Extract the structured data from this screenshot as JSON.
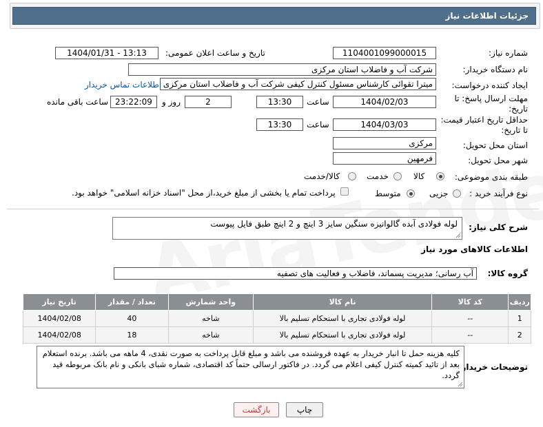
{
  "header": {
    "title": "جزئیات اطلاعات نیاز"
  },
  "form": {
    "need_number": {
      "label": "شماره نیاز:",
      "value": "1104001099000015"
    },
    "announce_datetime": {
      "label": "تاریخ و ساعت اعلان عمومی:",
      "value": "1404/01/31 - 13:13"
    },
    "buyer_org": {
      "label": "نام دستگاه خریدار:",
      "value": "شرکت آب و فاضلاب استان مرکزی"
    },
    "creator": {
      "label": "ایجاد کننده درخواست:",
      "value": "میترا تقوائی کارشناس مسئول کنترل کیفی شرکت آب و فاضلاب استان مرکزی",
      "contact_link": "اطلاعات تماس خریدار"
    },
    "reply_deadline": {
      "label": "مهلت ارسال پاسخ: تا تاریخ:",
      "date": "1404/02/03",
      "time_label": "ساعت",
      "time": "13:30",
      "days": "2",
      "days_label": "روز و",
      "remaining": "23:22:09",
      "remaining_label": "ساعت باقی مانده"
    },
    "price_validity": {
      "label": "حداقل تاریخ اعتبار قیمت: تا تاریخ:",
      "date": "1404/03/03",
      "time_label": "ساعت",
      "time": "13:30"
    },
    "province": {
      "label": "استان محل تحویل:",
      "value": "مرکزی"
    },
    "city": {
      "label": "شهر محل تحویل:",
      "value": "فرمهین"
    },
    "category": {
      "label": "طبقه بندی موضوعی:",
      "options": [
        "کالا",
        "خدمت",
        "کالا/خدمت"
      ],
      "selected": "کالا"
    },
    "process": {
      "label": "نوع فرآیند خرید :",
      "options": [
        "جزیی",
        "متوسط"
      ],
      "selected": "متوسط",
      "payment_note": "پرداخت تمام یا بخشی از مبلغ خرید،از محل \"اسناد خزانه اسلامی\" خواهد بود."
    }
  },
  "description": {
    "label": "شرح کلی نیاز:",
    "value": "لوله فولادی آبده گالوانیزه سنگین سایز 3 اینچ و 2 اینچ طبق فایل پیوست"
  },
  "goods_section": {
    "title": "اطلاعات کالاهای مورد نیاز"
  },
  "goods_group": {
    "label": "گروه کالا:",
    "value": "آب رسانی؛ مدیریت پسماند، فاضلاب و فعالیت های تصفیه"
  },
  "table": {
    "headers": [
      "ردیف",
      "کد کالا",
      "نام کالا",
      "واحد شمارش",
      "تعداد / مقدار",
      "تاریخ نیاز"
    ],
    "rows": [
      [
        "1",
        "--",
        "لوله فولادی تجاری با استحکام تسلیم بالا",
        "شاخه",
        "40",
        "1404/02/08"
      ],
      [
        "2",
        "--",
        "لوله فولادی تجاری با استحکام تسلیم بالا",
        "شاخه",
        "18",
        "1404/02/08"
      ]
    ]
  },
  "buyer_notes": {
    "label": "توضیحات خریدار:",
    "value": "کلیه هزینه حمل تا انبار خریدار به عهده فروشنده می باشد و مبلغ قابل پرداخت به صورت نقدی، 4 ماهه می باشد. برنده استعلام بعد از تائید کمیته کنترل کیفی اعلام می گردد. در فاکتور ارسالی حتماً کد اقتصادی، شماره شبای بانکی و نام بانک مربوطه قید گردد."
  },
  "buttons": {
    "print": "چاپ",
    "back": "بازگشت"
  },
  "watermark": {
    "text": "AriaTender.neT"
  },
  "colors": {
    "header_bg": "#4f6f8a",
    "table_header_bg": "#8a8f94",
    "link": "#0a58a8",
    "back_text": "#c0392b"
  }
}
